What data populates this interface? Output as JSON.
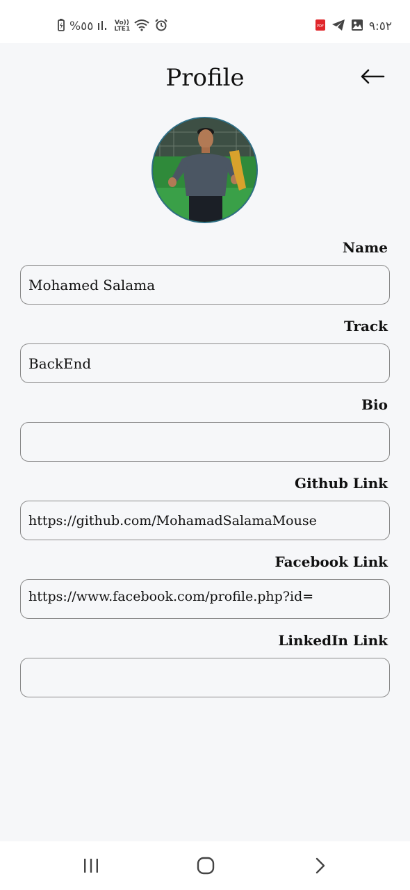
{
  "status_bar": {
    "battery_text": "%٥٥",
    "network_text": "Vo)) LTE1",
    "time": "٩:٥٢"
  },
  "header": {
    "title": "Profile",
    "back_icon": "arrow-left-icon"
  },
  "profile": {
    "fields": [
      {
        "label": "Name",
        "value": "Mohamed Salama"
      },
      {
        "label": "Track",
        "value": "BackEnd"
      },
      {
        "label": "Bio",
        "value": ""
      },
      {
        "label": "Github Link",
        "value": "https://github.com/MohamadSalamaMouse"
      },
      {
        "label": "Facebook Link",
        "value": "https://www.facebook.com/profile.php?id="
      },
      {
        "label": "LinkedIn Link",
        "value": ""
      }
    ]
  },
  "nav_bar": {
    "recent_icon": "recent-apps-icon",
    "home_icon": "home-icon",
    "back_icon": "chevron-right-icon"
  },
  "colors": {
    "background": "#f6f7f9",
    "field_border": "#8a8a8a",
    "avatar_ring": "#2f6f86"
  }
}
